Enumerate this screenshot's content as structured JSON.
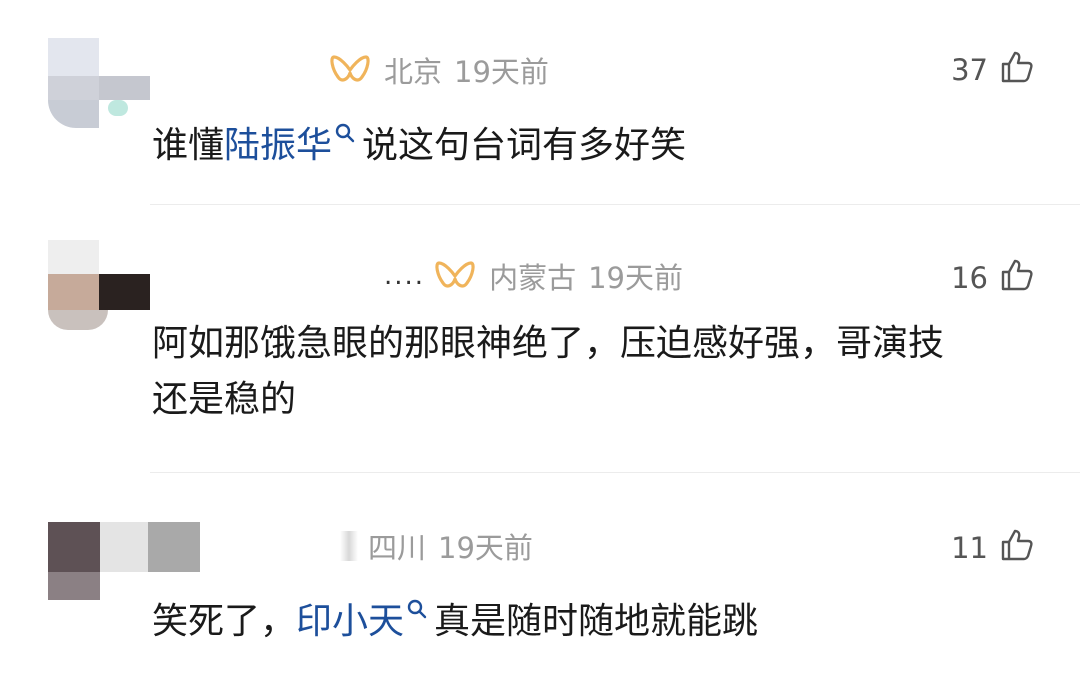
{
  "comments": [
    {
      "location": "北京",
      "time": "19天前",
      "likes": "37",
      "text_before": "谁懂",
      "mention": "陆振华",
      "text_after": "说这句台词有多好笑"
    },
    {
      "name_fragment": "....",
      "location": "内蒙古",
      "time": "19天前",
      "likes": "16",
      "text_line1": "阿如那饿急眼的那眼神绝了，压迫感好强，哥演技",
      "text_line2": "还是稳的"
    },
    {
      "location": "四川",
      "time": "19天前",
      "likes": "11",
      "text_before": "笑死了，",
      "mention": "印小天",
      "text_after": "真是随时随地就能跳"
    }
  ],
  "colors": {
    "mention": "#1d4f9b",
    "badge": "#f0b45b",
    "meta": "#9b9b9b",
    "divider": "#ececec"
  },
  "icons": [
    "vip-badge-icon",
    "search-icon",
    "thumbs-up-icon"
  ]
}
